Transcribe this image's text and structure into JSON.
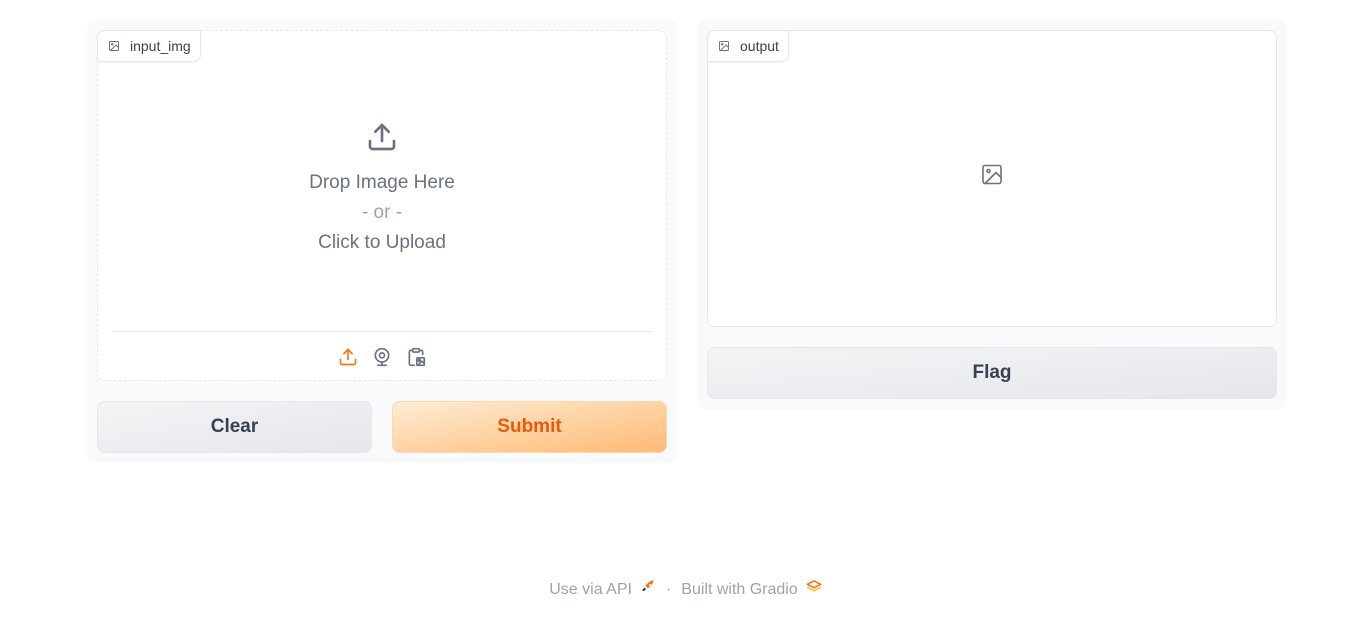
{
  "input": {
    "label": "input_img",
    "drop_text": "Drop Image Here",
    "or_text": "- or -",
    "click_text": "Click to Upload",
    "sources": [
      "upload-icon",
      "webcam-icon",
      "clipboard-icon"
    ]
  },
  "output": {
    "label": "output"
  },
  "buttons": {
    "clear": "Clear",
    "submit": "Submit",
    "flag": "Flag"
  },
  "footer": {
    "api_text": "Use via API",
    "separator": "·",
    "built_text": "Built with Gradio"
  },
  "colors": {
    "accent": "#f97316",
    "submit_text": "#ea580c",
    "panel_bg": "#f9fafb",
    "border": "#e5e7eb"
  }
}
